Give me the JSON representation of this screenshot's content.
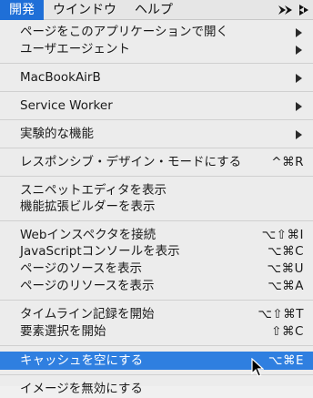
{
  "menubar": {
    "items": [
      "開発",
      "ウインドウ",
      "ヘルプ"
    ]
  },
  "menu": {
    "rows": [
      {
        "label": "ページをこのアプリケーションで開く",
        "submenu": true
      },
      {
        "label": "ユーザエージェント",
        "submenu": true
      },
      {
        "label": "MacBookAirB",
        "submenu": true
      },
      {
        "label": "Service Worker",
        "submenu": true
      },
      {
        "label": "実験的な機能",
        "submenu": true
      },
      {
        "label": "レスポンシブ・デザイン・モードにする",
        "shortcut": "^⌘R"
      },
      {
        "label": "スニペットエディタを表示"
      },
      {
        "label": "機能拡張ビルダーを表示"
      },
      {
        "label": "Webインスペクタを接続",
        "shortcut": "⌥⇧⌘I"
      },
      {
        "label": "JavaScriptコンソールを表示",
        "shortcut": "⌥⌘C"
      },
      {
        "label": "ページのソースを表示",
        "shortcut": "⌥⌘U"
      },
      {
        "label": "ページのリソースを表示",
        "shortcut": "⌥⌘A"
      },
      {
        "label": "タイムライン記録を開始",
        "shortcut": "⌥⇧⌘T"
      },
      {
        "label": "要素選択を開始",
        "shortcut": "⇧⌘C"
      },
      {
        "label": "キャッシュを空にする",
        "shortcut": "⌥⌘E",
        "highlighted": true
      },
      {
        "label": "イメージを無効にする"
      }
    ]
  },
  "colors": {
    "highlight": "#2f7fe0",
    "active_menu": "#1f6fd7"
  }
}
